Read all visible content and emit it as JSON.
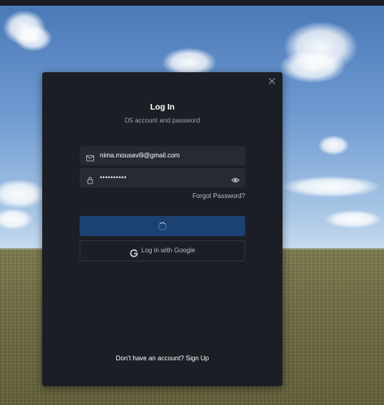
{
  "dialog": {
    "title": "Log In",
    "subtitle": "D5 account and password"
  },
  "form": {
    "email_value": "nima.mousavi9@gmail.com",
    "password_masked": "••••••••••",
    "forgot_label": "Forgot Password?",
    "login_state": "loading",
    "google_label": "Log in with Google"
  },
  "footer": {
    "prompt": "Don't have an account?",
    "signup_label": "Sign Up"
  },
  "icons": {
    "close": "close-icon",
    "email": "mail-icon",
    "password": "lock-icon",
    "show_password": "eye-icon",
    "google": "google-icon",
    "loading": "spinner-icon"
  },
  "colors": {
    "dialog_bg": "#1c1e26",
    "field_bg": "#272a33",
    "login_button": "#1c4272",
    "text_primary": "#ffffff",
    "text_secondary": "#9ea3b0"
  }
}
